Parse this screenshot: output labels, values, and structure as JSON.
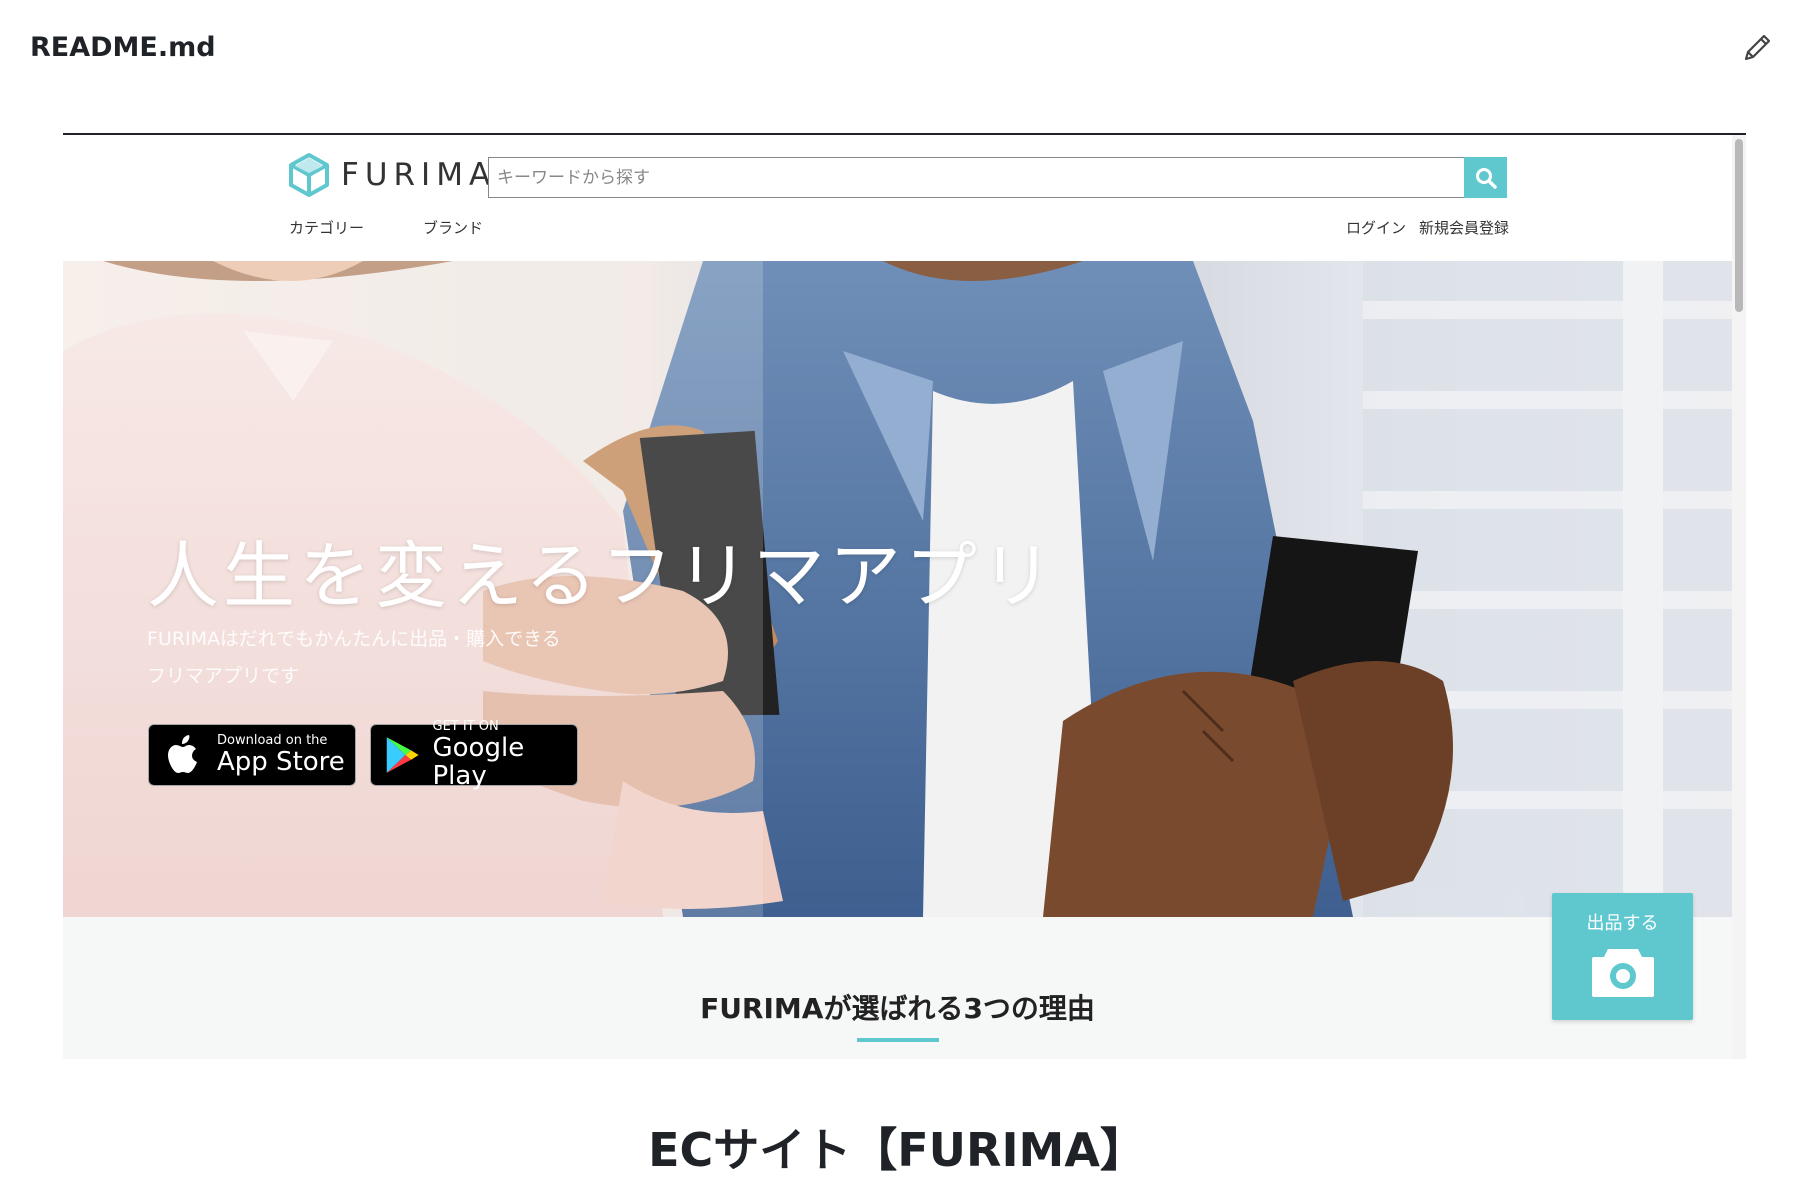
{
  "readme": {
    "filename": "README.md",
    "edit_icon": "pencil-icon"
  },
  "furima": {
    "logo_text": "FURIMA",
    "search_placeholder": "キーワードから探す",
    "nav": {
      "category": "カテゴリー",
      "brand": "ブランド",
      "login": "ログイン",
      "signup": "新規会員登録"
    },
    "hero": {
      "catchphrase": "人生を変えるフリマアプリ",
      "sub_line1": "FURIMAはだれでもかんたんに出品・購入できる",
      "sub_line2": "フリマアプリです"
    },
    "badges": {
      "appstore_small": "Download on the",
      "appstore_big": "App Store",
      "googleplay_small": "GET IT ON",
      "googleplay_big": "Google Play"
    },
    "sell_button": "出品する",
    "reasons_title": "FURIMAが選ばれる3つの理由"
  },
  "main_heading": "ECサイト【FURIMA】",
  "colors": {
    "accent": "#5fc8cf",
    "text": "#1f2328"
  }
}
